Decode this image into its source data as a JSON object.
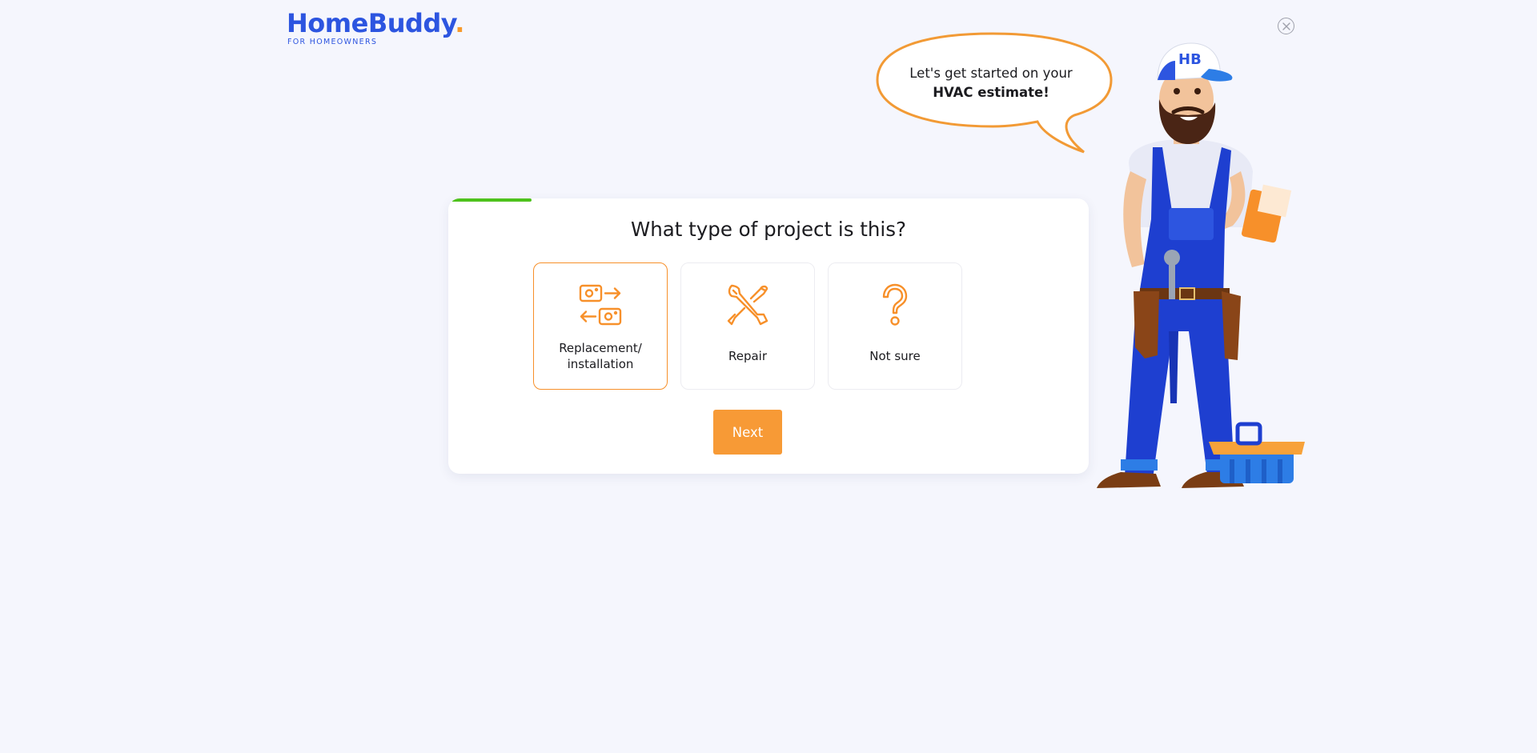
{
  "logo": {
    "name": "HomeBuddy",
    "dot": ".",
    "tagline": "FOR HOMEOWNERS"
  },
  "close": {
    "icon": "close-icon"
  },
  "bubble": {
    "line1": "Let's get started on your",
    "line2": "HVAC estimate!"
  },
  "progress": {
    "fraction": 0.125
  },
  "question": "What type of project is this?",
  "options": [
    {
      "label": "Replacement/\ninstallation",
      "icon": "swap-arrows-icon",
      "selected": true
    },
    {
      "label": "Repair",
      "icon": "tools-icon",
      "selected": false
    },
    {
      "label": "Not sure",
      "icon": "question-mark-icon",
      "selected": false
    }
  ],
  "next_button": "Next",
  "colors": {
    "brand_blue": "#2d55e0",
    "accent_orange": "#f7902a",
    "progress_green": "#4ec21c",
    "background": "#f5f6fd"
  },
  "mascot": {
    "cap_text": "HB"
  }
}
